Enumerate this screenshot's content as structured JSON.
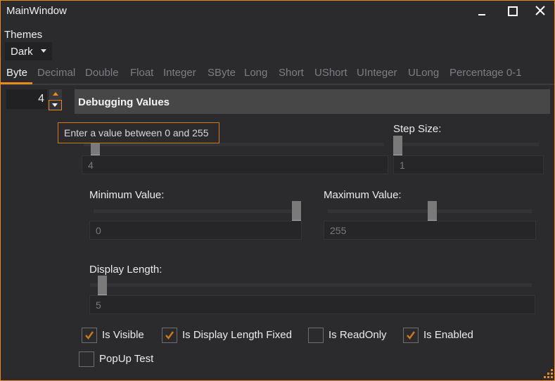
{
  "window": {
    "title": "MainWindow",
    "controls": {
      "minimize": "minimize-icon",
      "maximize": "maximize-icon",
      "close": "close-icon"
    },
    "accent_color": "#e88a1a"
  },
  "themes": {
    "label": "Themes",
    "selected": "Dark"
  },
  "tabs": [
    {
      "label": "Byte",
      "active": true
    },
    {
      "label": "Decimal"
    },
    {
      "label": "Double"
    },
    {
      "label": "Float"
    },
    {
      "label": "Integer"
    },
    {
      "label": "SByte"
    },
    {
      "label": "Long"
    },
    {
      "label": "Short"
    },
    {
      "label": "UShort"
    },
    {
      "label": "UInteger"
    },
    {
      "label": "ULong"
    },
    {
      "label": "Percentage 0-1"
    }
  ],
  "numeric_up_down": {
    "value": "4",
    "tooltip": "Enter a value between 0 and 255"
  },
  "debug": {
    "header": "Debugging Values",
    "value": {
      "field": "4",
      "slider_fraction": 0.016
    },
    "step_size": {
      "label": "Step Size:",
      "field": "1",
      "slider_fraction": 0.0
    },
    "minimum": {
      "label": "Minimum Value:",
      "field": "0",
      "slider_fraction": 1.0
    },
    "maximum": {
      "label": "Maximum Value:",
      "field": "255",
      "slider_fraction": 0.5
    },
    "display_length": {
      "label": "Display Length:",
      "field": "5",
      "slider_fraction": 0.0
    }
  },
  "checkboxes": [
    {
      "label": "Is Visible",
      "checked": true
    },
    {
      "label": "Is Display Length Fixed",
      "checked": true
    },
    {
      "label": "Is ReadOnly",
      "checked": false
    },
    {
      "label": "Is Enabled",
      "checked": true
    },
    {
      "label": "PopUp Test",
      "checked": false
    }
  ]
}
